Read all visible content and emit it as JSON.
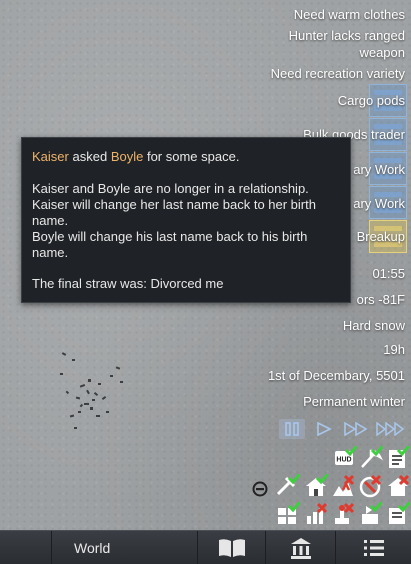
{
  "alerts": [
    {
      "text": "Need warm clothes"
    },
    {
      "text": "Hunter lacks ranged weapon"
    },
    {
      "text": "Need recreation variety"
    }
  ],
  "alert_cargo": "Cargo pods",
  "alert_trader": "Bulk goods trader",
  "alert_work_1": "ary Work",
  "alert_work_2": "ary Work",
  "alert_breakup": "Breakup",
  "tooltip": {
    "name_a": "Kaiser",
    "word_asked": "asked",
    "name_b": "Boyle",
    "line1_rest": "for some space.",
    "line2": "Kaiser and Boyle are no longer in a relationship.",
    "line3": "Kaiser will change her last name back to her birth name.",
    "line4": "Boyle will change his last name back to his birth name.",
    "line5": "The final straw was: Divorced me"
  },
  "info": {
    "time": "01:55",
    "temperature": "ors -81F",
    "weather": "Hard snow",
    "hour": "19h",
    "date": "1st of Decembary, 5501",
    "biome": "Permanent winter"
  },
  "speed_controls": [
    "pause",
    "normal",
    "fast",
    "superfast"
  ],
  "speed_active": "pause",
  "bottom_bar": {
    "world_label": "World"
  },
  "colors": {
    "pawn_name": "#eeb36a",
    "alert_blue": "#8fb3d9",
    "alert_yellow": "#e6d27a",
    "check_green": "#3ecf3e",
    "cross_red": "#e03a2e"
  }
}
